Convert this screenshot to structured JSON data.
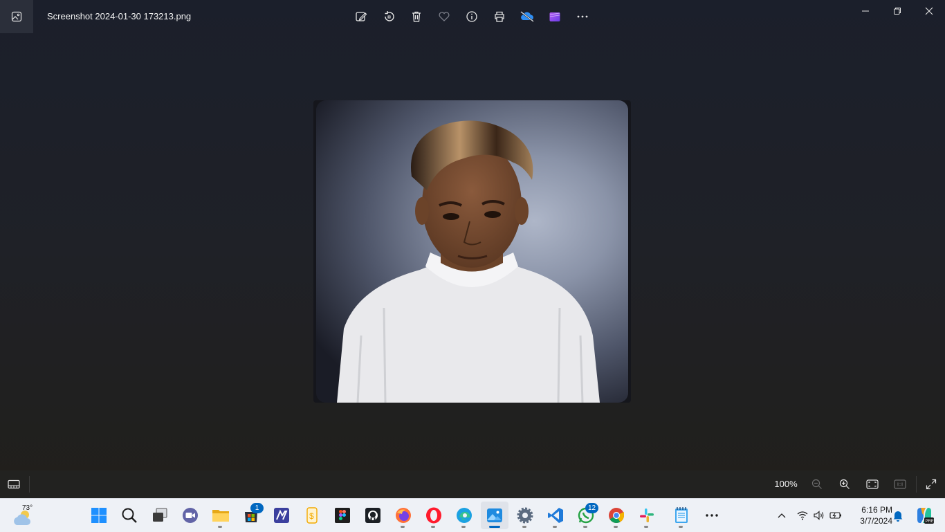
{
  "window": {
    "file_name": "Screenshot 2024-01-30 173213.png",
    "app_icon": "photos-app-icon",
    "toolbar": [
      {
        "name": "edit-image-icon",
        "label": "Edit image"
      },
      {
        "name": "rotate-icon",
        "label": "Rotate"
      },
      {
        "name": "delete-icon",
        "label": "Delete"
      },
      {
        "name": "favorite-heart-icon",
        "label": "Favorite"
      },
      {
        "name": "info-icon",
        "label": "File information"
      },
      {
        "name": "print-icon",
        "label": "Print"
      },
      {
        "name": "onedrive-sync-off-icon",
        "label": "OneDrive"
      },
      {
        "name": "clipchamp-icon",
        "label": "Clipchamp"
      },
      {
        "name": "more-options-icon",
        "label": "See more"
      }
    ],
    "controls": [
      "minimize-icon",
      "restore-icon",
      "close-icon"
    ]
  },
  "viewer": {
    "zoom_level": "100%"
  },
  "taskbar": {
    "weather_temp": "73°",
    "apps": [
      {
        "name": "start-button"
      },
      {
        "name": "search-button"
      },
      {
        "name": "task-view-button"
      },
      {
        "name": "teams-meet-app"
      },
      {
        "name": "file-explorer-app"
      },
      {
        "name": "microsoft-store-app",
        "badge": "1"
      },
      {
        "name": "notion-like-app"
      },
      {
        "name": "sketch-app"
      },
      {
        "name": "figma-app"
      },
      {
        "name": "github-app"
      },
      {
        "name": "firefox-app"
      },
      {
        "name": "opera-app"
      },
      {
        "name": "edge-app"
      },
      {
        "name": "photos-app"
      },
      {
        "name": "settings-app"
      },
      {
        "name": "vscode-app"
      },
      {
        "name": "whatsapp-app",
        "badge": "12"
      },
      {
        "name": "chrome-app"
      },
      {
        "name": "slack-app"
      },
      {
        "name": "notepad-app"
      },
      {
        "name": "more-apps-button"
      }
    ],
    "time": "6:16 PM",
    "date": "3/7/2024"
  }
}
